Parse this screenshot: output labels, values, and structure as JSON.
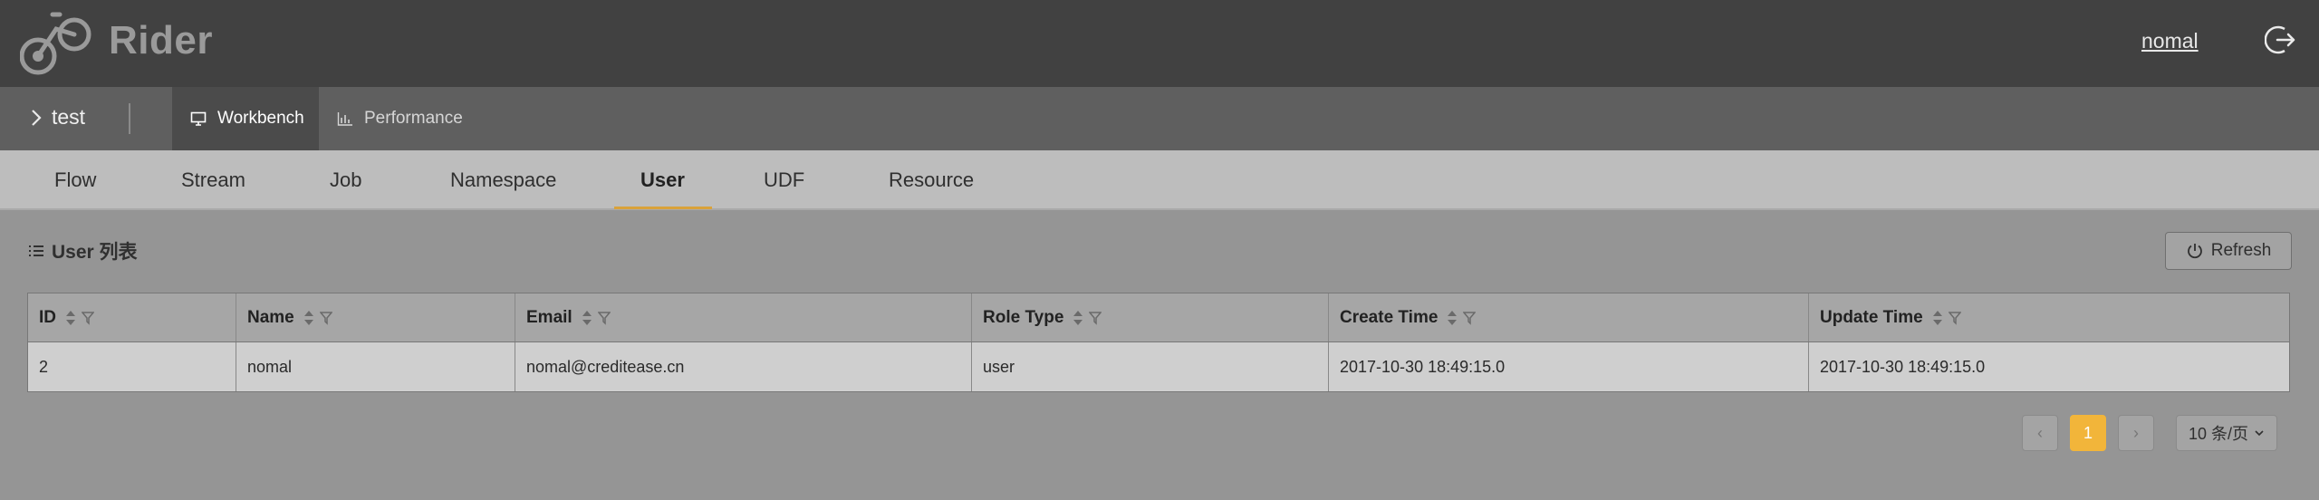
{
  "app": {
    "brand": "Rider",
    "user": "nomal"
  },
  "project": {
    "name": "test"
  },
  "modes": [
    {
      "label": "Workbench",
      "icon": "monitor-icon"
    },
    {
      "label": "Performance",
      "icon": "bar-chart-icon"
    }
  ],
  "subtabs": [
    "Flow",
    "Stream",
    "Job",
    "Namespace",
    "User",
    "UDF",
    "Resource"
  ],
  "active_subtab": "User",
  "section": {
    "title": "User 列表",
    "refresh_label": "Refresh"
  },
  "table": {
    "columns": [
      "ID",
      "Name",
      "Email",
      "Role Type",
      "Create Time",
      "Update Time"
    ],
    "rows": [
      [
        "2",
        "nomal",
        "nomal@creditease.cn",
        "user",
        "2017-10-30 18:49:15.0",
        "2017-10-30 18:49:15.0"
      ]
    ]
  },
  "pagination": {
    "prev": "‹",
    "current": "1",
    "next": "›",
    "page_size": "10 条/页"
  },
  "colors": {
    "accent": "#f2b53a",
    "header_bg": "#414141",
    "underline": "#d9a23a"
  }
}
